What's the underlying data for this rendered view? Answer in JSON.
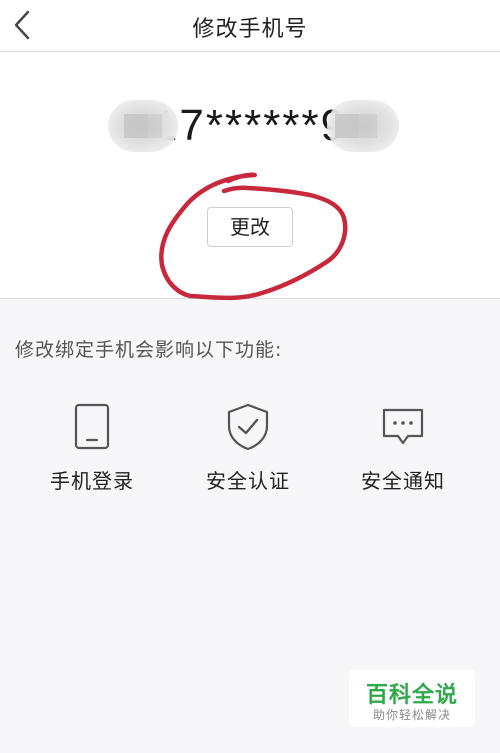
{
  "header": {
    "title": "修改手机号",
    "back_icon": "chevron-left-icon"
  },
  "phone": {
    "masked_number": "17******9"
  },
  "change_button": {
    "label": "更改"
  },
  "info": {
    "text": "修改绑定手机会影响以下功能:"
  },
  "features": [
    {
      "label": "手机登录",
      "icon": "phone-icon"
    },
    {
      "label": "安全认证",
      "icon": "shield-check-icon"
    },
    {
      "label": "安全通知",
      "icon": "message-icon"
    }
  ],
  "watermark": {
    "title": "百科全说",
    "subtitle": "助你轻松解决"
  },
  "colors": {
    "annotation_red": "#c8283c",
    "watermark_green": "#2fa94a",
    "icon_gray": "#555555"
  }
}
